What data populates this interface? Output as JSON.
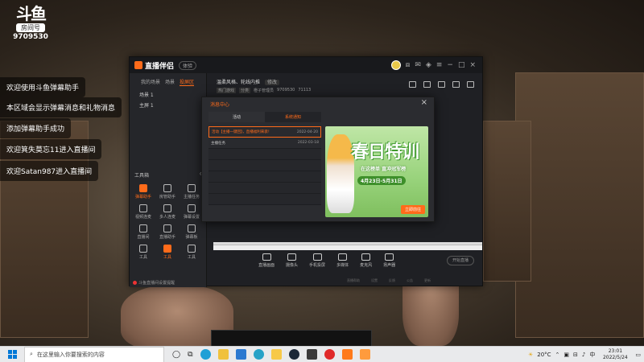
{
  "overlay": {
    "logo_big": "斗鱼",
    "room_label": "房间号",
    "room_number": "9709530",
    "chat_messages": [
      "欢迎使用斗鱼弹幕助手",
      "本区域会显示弹幕消息和礼物消息",
      "添加弹幕助手成功",
      "欢迎箕失莫忘11进入直播间",
      "欢迎Satan987进入直播间"
    ]
  },
  "app": {
    "title": "直播伴侣",
    "version_pill": "体验",
    "left_tabs": [
      "我的场景",
      "场景",
      "投屏区"
    ],
    "scene_rows": [
      "场景 1",
      "主屏 1"
    ],
    "tools_title": "工具箱",
    "tools": [
      {
        "label": "弹幕助手",
        "hot": true
      },
      {
        "label": "房管助手",
        "hot": false
      },
      {
        "label": "主播任务",
        "hot": false
      },
      {
        "label": "视频连麦",
        "hot": false
      },
      {
        "label": "多人连麦",
        "hot": false
      },
      {
        "label": "弹幕设置",
        "hot": false
      },
      {
        "label": "直播间",
        "hot": false
      },
      {
        "label": "直播助手",
        "hot": false
      },
      {
        "label": "弹幕板",
        "hot": false
      },
      {
        "label": "工具",
        "hot": false
      },
      {
        "label": "工具",
        "hot": false
      },
      {
        "label": "工具",
        "hot": false
      }
    ],
    "left_footer": "斗鱼直播间设置提醒",
    "stream_title": "温柔风格、轮线内推",
    "stream_badge": "修改",
    "stream_meta": [
      "热门游戏",
      "分类",
      "橙子管理员",
      "9709530",
      "71113"
    ],
    "bottom_controls": [
      "直播画面",
      "摄像头",
      "手机投屏",
      "多媒体",
      "麦克风",
      "扬声器"
    ],
    "start_label": "开始直播",
    "footer_links": [
      "直播帮助",
      "设置",
      "反馈",
      "公告",
      "更新"
    ]
  },
  "modal": {
    "title": "消息中心",
    "close": "×",
    "tabs": [
      "活动",
      "系统通知"
    ],
    "messages": [
      {
        "text": "活动【主播一键回】，直播福利来袭！",
        "date": "2022-04-20",
        "highlighted": true
      },
      {
        "text": "主播任务",
        "date": "2022-03-18",
        "highlighted": false
      }
    ],
    "promo": {
      "title": "春日特训",
      "line1": "在这榜单 直冲冠军榜",
      "line2": "4月23日-5月31日",
      "button": "立即前往"
    }
  },
  "taskbar": {
    "search_placeholder": "在这里输入你要搜索的内容",
    "temperature": "20°C",
    "time": "23:01",
    "date": "2022/5/24",
    "lang": "中"
  }
}
